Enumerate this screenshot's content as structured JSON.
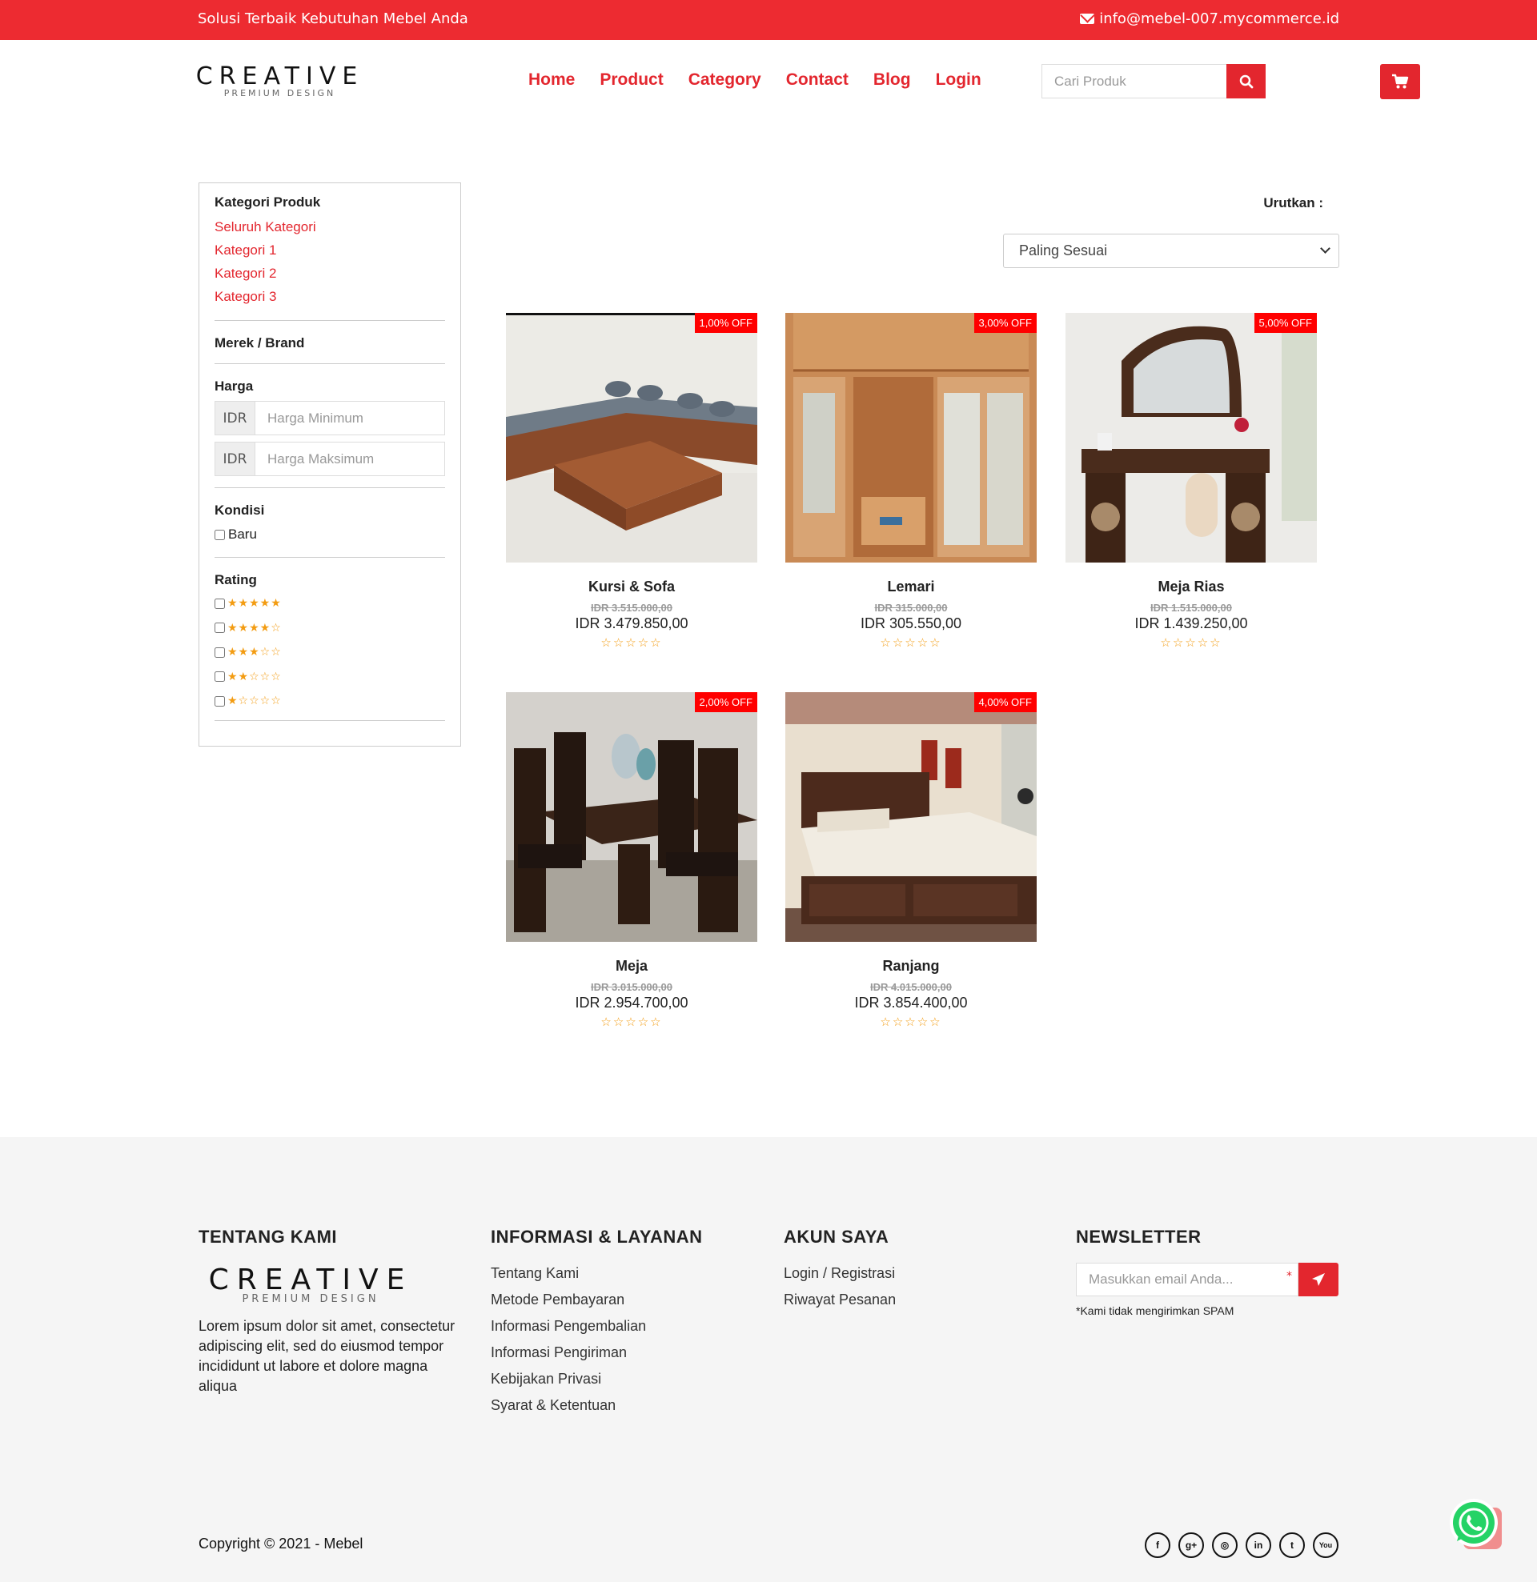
{
  "topbar": {
    "tagline": "Solusi Terbaik Kebutuhan Mebel Anda",
    "email": "info@mebel-007.mycommerce.id"
  },
  "brand": {
    "name": "CREATIVE",
    "subtitle": "PREMIUM DESIGN"
  },
  "nav": [
    "Home",
    "Product",
    "Category",
    "Contact",
    "Blog",
    "Login"
  ],
  "search": {
    "placeholder": "Cari Produk"
  },
  "sidebar": {
    "category_title": "Kategori Produk",
    "categories": [
      "Seluruh Kategori",
      "Kategori 1",
      "Kategori 2",
      "Kategori 3"
    ],
    "brand_title": "Merek / Brand",
    "price_title": "Harga",
    "currency": "IDR",
    "min_placeholder": "Harga Minimum",
    "max_placeholder": "Harga Maksimum",
    "condition_title": "Kondisi",
    "condition_option": "Baru",
    "rating_title": "Rating",
    "rating_options": [
      5,
      4,
      3,
      2,
      1
    ]
  },
  "sort": {
    "label": "Urutkan :",
    "selected": "Paling Sesuai"
  },
  "products": [
    {
      "name": "Kursi & Sofa",
      "badge": "1,00% OFF",
      "old_price": "IDR 3.515.000,00",
      "price": "IDR 3.479.850,00",
      "rating": "☆☆☆☆☆"
    },
    {
      "name": "Lemari",
      "badge": "3,00% OFF",
      "old_price": "IDR 315.000,00",
      "price": "IDR 305.550,00",
      "rating": "☆☆☆☆☆"
    },
    {
      "name": "Meja Rias",
      "badge": "5,00% OFF",
      "old_price": "IDR 1.515.000,00",
      "price": "IDR 1.439.250,00",
      "rating": "☆☆☆☆☆"
    },
    {
      "name": "Meja",
      "badge": "2,00% OFF",
      "old_price": "IDR 3.015.000,00",
      "price": "IDR 2.954.700,00",
      "rating": "☆☆☆☆☆"
    },
    {
      "name": "Ranjang",
      "badge": "4,00% OFF",
      "old_price": "IDR 4.015.000,00",
      "price": "IDR 3.854.400,00",
      "rating": "☆☆☆☆☆"
    }
  ],
  "footer": {
    "about": {
      "title": "TENTANG KAMI",
      "text": "Lorem ipsum dolor sit amet, consectetur adipiscing elit, sed do eiusmod tempor incididunt ut labore et dolore magna aliqua"
    },
    "info": {
      "title": "INFORMASI & LAYANAN",
      "links": [
        "Tentang Kami",
        "Metode Pembayaran",
        "Informasi Pengembalian",
        "Informasi Pengiriman",
        "Kebijakan Privasi",
        "Syarat & Ketentuan"
      ]
    },
    "account": {
      "title": "AKUN SAYA",
      "links": [
        "Login / Registrasi",
        "Riwayat Pesanan"
      ]
    },
    "newsletter": {
      "title": "NEWSLETTER",
      "placeholder": "Masukkan email Anda...",
      "required_mark": "*",
      "note": "*Kami tidak mengirimkan SPAM"
    },
    "copyright": "Copyright © 2021 - Mebel",
    "socials": [
      "facebook-icon",
      "google-plus-icon",
      "instagram-icon",
      "linkedin-icon",
      "twitter-icon",
      "youtube-icon"
    ],
    "social_glyphs": [
      "f",
      "g+",
      "◎",
      "in",
      "t",
      "You"
    ]
  },
  "colors": {
    "accent": "#e3262e",
    "topbar": "#ed2b31",
    "badge": "#ff0000",
    "star": "#f39c12",
    "footer_bg": "#f5f5f5"
  }
}
